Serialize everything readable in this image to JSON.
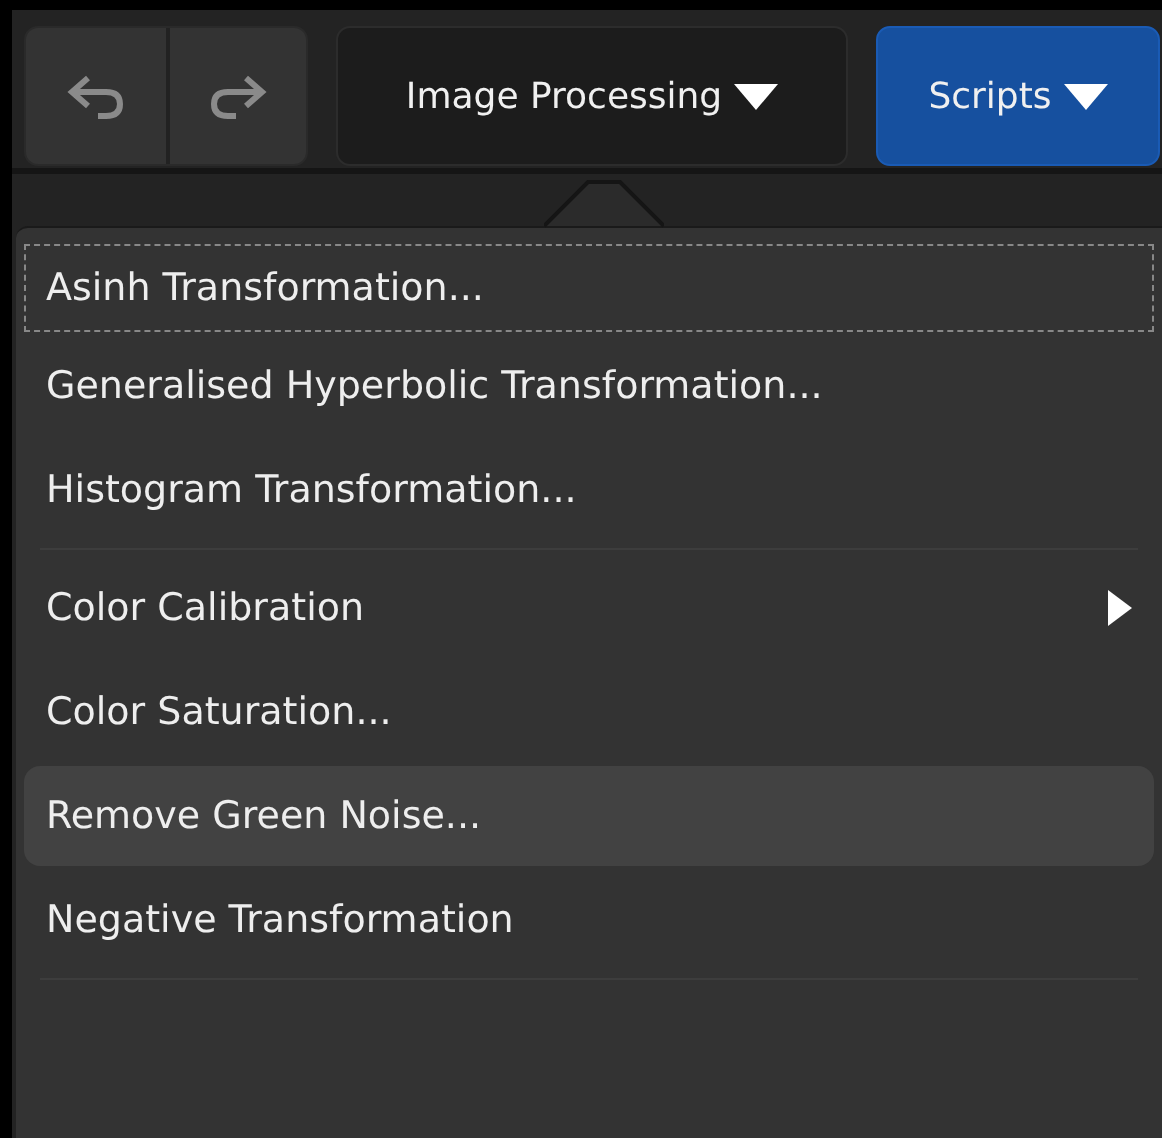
{
  "toolbar": {
    "history_buttons": [
      {
        "kind": "undo"
      },
      {
        "kind": "redo"
      }
    ],
    "menus": [
      {
        "label": "Image Processing",
        "selected": true
      },
      {
        "label": "Scripts",
        "selected": false
      }
    ]
  },
  "menu": {
    "items": [
      {
        "kind": "item",
        "label": "Asinh Transformation...",
        "focused": true,
        "highlighted": false,
        "submenu": false
      },
      {
        "kind": "item",
        "label": "Generalised Hyperbolic Transformation...",
        "focused": false,
        "highlighted": false,
        "submenu": false
      },
      {
        "kind": "item",
        "label": "Histogram Transformation...",
        "focused": false,
        "highlighted": false,
        "submenu": false
      },
      {
        "kind": "separator"
      },
      {
        "kind": "item",
        "label": "Color Calibration",
        "focused": false,
        "highlighted": false,
        "submenu": true
      },
      {
        "kind": "item",
        "label": "Color Saturation...",
        "focused": false,
        "highlighted": false,
        "submenu": false
      },
      {
        "kind": "item",
        "label": "Remove Green Noise...",
        "focused": false,
        "highlighted": true,
        "submenu": false
      },
      {
        "kind": "item",
        "label": "Negative Transformation",
        "focused": false,
        "highlighted": false,
        "submenu": false
      },
      {
        "kind": "separator"
      }
    ]
  }
}
